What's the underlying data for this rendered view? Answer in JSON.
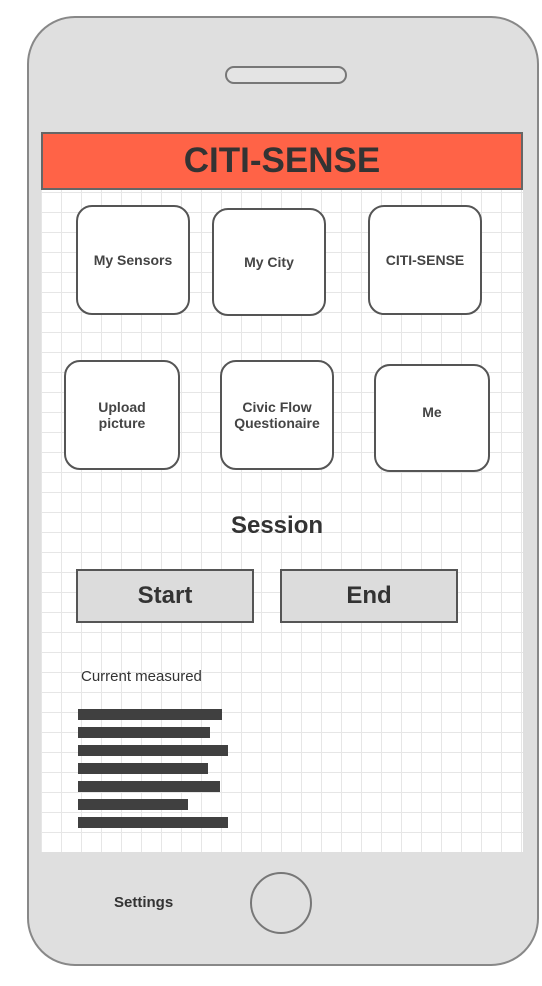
{
  "header": {
    "title": "CITI-SENSE"
  },
  "tiles": {
    "my_sensors": "My Sensors",
    "my_city": "My City",
    "citi_sense": "CITI-SENSE",
    "upload_picture": "Upload\npicture",
    "civic_flow": "Civic Flow\nQuestionaire",
    "me": "Me"
  },
  "session": {
    "title": "Session",
    "start_label": "Start",
    "end_label": "End"
  },
  "measurements": {
    "label": "Current measured"
  },
  "footer": {
    "settings_label": "Settings"
  },
  "colors": {
    "header_bg": "#ff6347",
    "phone_body": "#dfdfdf",
    "button_bg": "#dcdcdc",
    "bar_fill": "#404040"
  }
}
